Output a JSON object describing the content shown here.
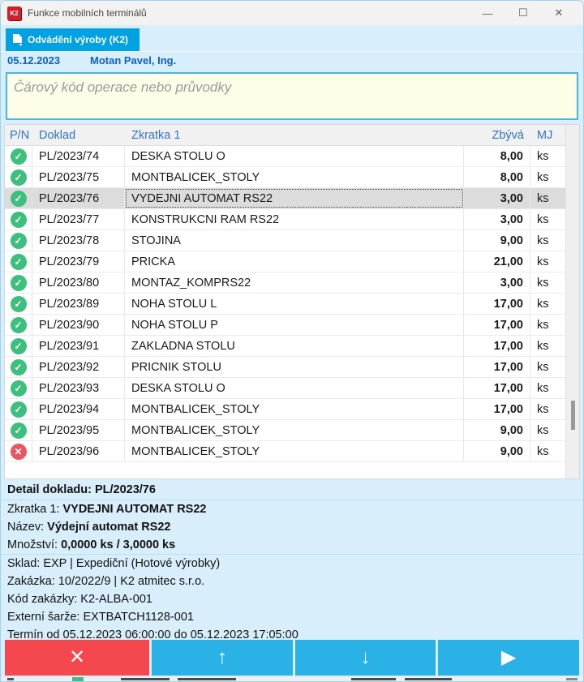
{
  "window": {
    "title": "Funkce mobilních terminálů",
    "logo_text": "K2",
    "controls": {
      "minimize": "—",
      "maximize": "☐",
      "close": "✕"
    }
  },
  "tab": {
    "label": "Odvádění výroby (K2)"
  },
  "info_bar": {
    "date": "05.12.2023",
    "user": "Motan Pavel, Ing."
  },
  "scan_input": {
    "placeholder": "Čárový kód operace nebo průvodky",
    "value": ""
  },
  "table": {
    "columns": {
      "pn": "P/N",
      "doklad": "Doklad",
      "zkratka": "Zkratka 1",
      "zbyva": "Zbývá",
      "mj": "MJ"
    },
    "selected_index": 2,
    "rows": [
      {
        "status": "ok",
        "doklad": "PL/2023/74",
        "zkratka": "DESKA STOLU O",
        "zbyva": "8,00",
        "mj": "ks"
      },
      {
        "status": "ok",
        "doklad": "PL/2023/75",
        "zkratka": "MONTBALICEK_STOLY",
        "zbyva": "8,00",
        "mj": "ks"
      },
      {
        "status": "ok",
        "doklad": "PL/2023/76",
        "zkratka": "VYDEJNI AUTOMAT RS22",
        "zbyva": "3,00",
        "mj": "ks"
      },
      {
        "status": "ok",
        "doklad": "PL/2023/77",
        "zkratka": "KONSTRUKCNI RAM RS22",
        "zbyva": "3,00",
        "mj": "ks"
      },
      {
        "status": "ok",
        "doklad": "PL/2023/78",
        "zkratka": "STOJINA",
        "zbyva": "9,00",
        "mj": "ks"
      },
      {
        "status": "ok",
        "doklad": "PL/2023/79",
        "zkratka": "PRICKA",
        "zbyva": "21,00",
        "mj": "ks"
      },
      {
        "status": "ok",
        "doklad": "PL/2023/80",
        "zkratka": "MONTAZ_KOMPRS22",
        "zbyva": "3,00",
        "mj": "ks"
      },
      {
        "status": "ok",
        "doklad": "PL/2023/89",
        "zkratka": "NOHA STOLU L",
        "zbyva": "17,00",
        "mj": "ks"
      },
      {
        "status": "ok",
        "doklad": "PL/2023/90",
        "zkratka": "NOHA STOLU P",
        "zbyva": "17,00",
        "mj": "ks"
      },
      {
        "status": "ok",
        "doklad": "PL/2023/91",
        "zkratka": "ZAKLADNA STOLU",
        "zbyva": "17,00",
        "mj": "ks"
      },
      {
        "status": "ok",
        "doklad": "PL/2023/92",
        "zkratka": "PRICNIK STOLU",
        "zbyva": "17,00",
        "mj": "ks"
      },
      {
        "status": "ok",
        "doklad": "PL/2023/93",
        "zkratka": "DESKA STOLU O",
        "zbyva": "17,00",
        "mj": "ks"
      },
      {
        "status": "ok",
        "doklad": "PL/2023/94",
        "zkratka": "MONTBALICEK_STOLY",
        "zbyva": "17,00",
        "mj": "ks"
      },
      {
        "status": "ok",
        "doklad": "PL/2023/95",
        "zkratka": "MONTBALICEK_STOLY",
        "zbyva": "9,00",
        "mj": "ks"
      },
      {
        "status": "error",
        "doklad": "PL/2023/96",
        "zkratka": "MONTBALICEK_STOLY",
        "zbyva": "9,00",
        "mj": "ks"
      }
    ]
  },
  "status_icons": {
    "ok": "✓",
    "error": "✕"
  },
  "detail": {
    "title": "Detail dokladu: PL/2023/76",
    "lines": [
      {
        "label": "Zkratka 1:",
        "value": "VYDEJNI AUTOMAT RS22",
        "bold": true,
        "divider_after": false
      },
      {
        "label": "Název:",
        "value": "Výdejní automat RS22",
        "bold": true,
        "divider_after": false
      },
      {
        "label": "Množství:",
        "value": "0,0000 ks / 3,0000 ks",
        "bold": true,
        "divider_after": true
      },
      {
        "label": "Sklad:",
        "value": "EXP | Expediční (Hotové výrobky)",
        "bold": false,
        "divider_after": false
      },
      {
        "label": "Zakázka:",
        "value": "10/2022/9 | K2 atmitec s.r.o.",
        "bold": false,
        "divider_after": false
      },
      {
        "label": "Kód zakázky:",
        "value": "K2-ALBA-001",
        "bold": false,
        "divider_after": false
      },
      {
        "label": "Externí šarže:",
        "value": "EXTBATCH1128-001",
        "bold": false,
        "divider_after": false
      },
      {
        "label": "Termín od 05.12.2023 06:00:00 do 05.12.2023 17:05:00",
        "value": "",
        "bold": false,
        "divider_after": false
      }
    ]
  },
  "buttons": [
    {
      "name": "cancel",
      "glyph": "✕",
      "color": "#f4474e"
    },
    {
      "name": "move-up",
      "glyph": "↑",
      "color": "#2ab2e6"
    },
    {
      "name": "move-down",
      "glyph": "↓",
      "color": "#2ab2e6"
    },
    {
      "name": "confirm",
      "glyph": "▶",
      "color": "#2ab2e6"
    }
  ],
  "colors": {
    "accent_blue": "#00a2e4",
    "light_blue_bg": "#d8eefa",
    "ok_green": "#3dbf7d",
    "error_red": "#ea5660",
    "button_red": "#f4474e",
    "button_cyan": "#2ab2e6",
    "header_text_blue": "#2e74c9",
    "info_text_blue": "#0a62c6",
    "input_bg_yellow": "#fdfde8"
  }
}
